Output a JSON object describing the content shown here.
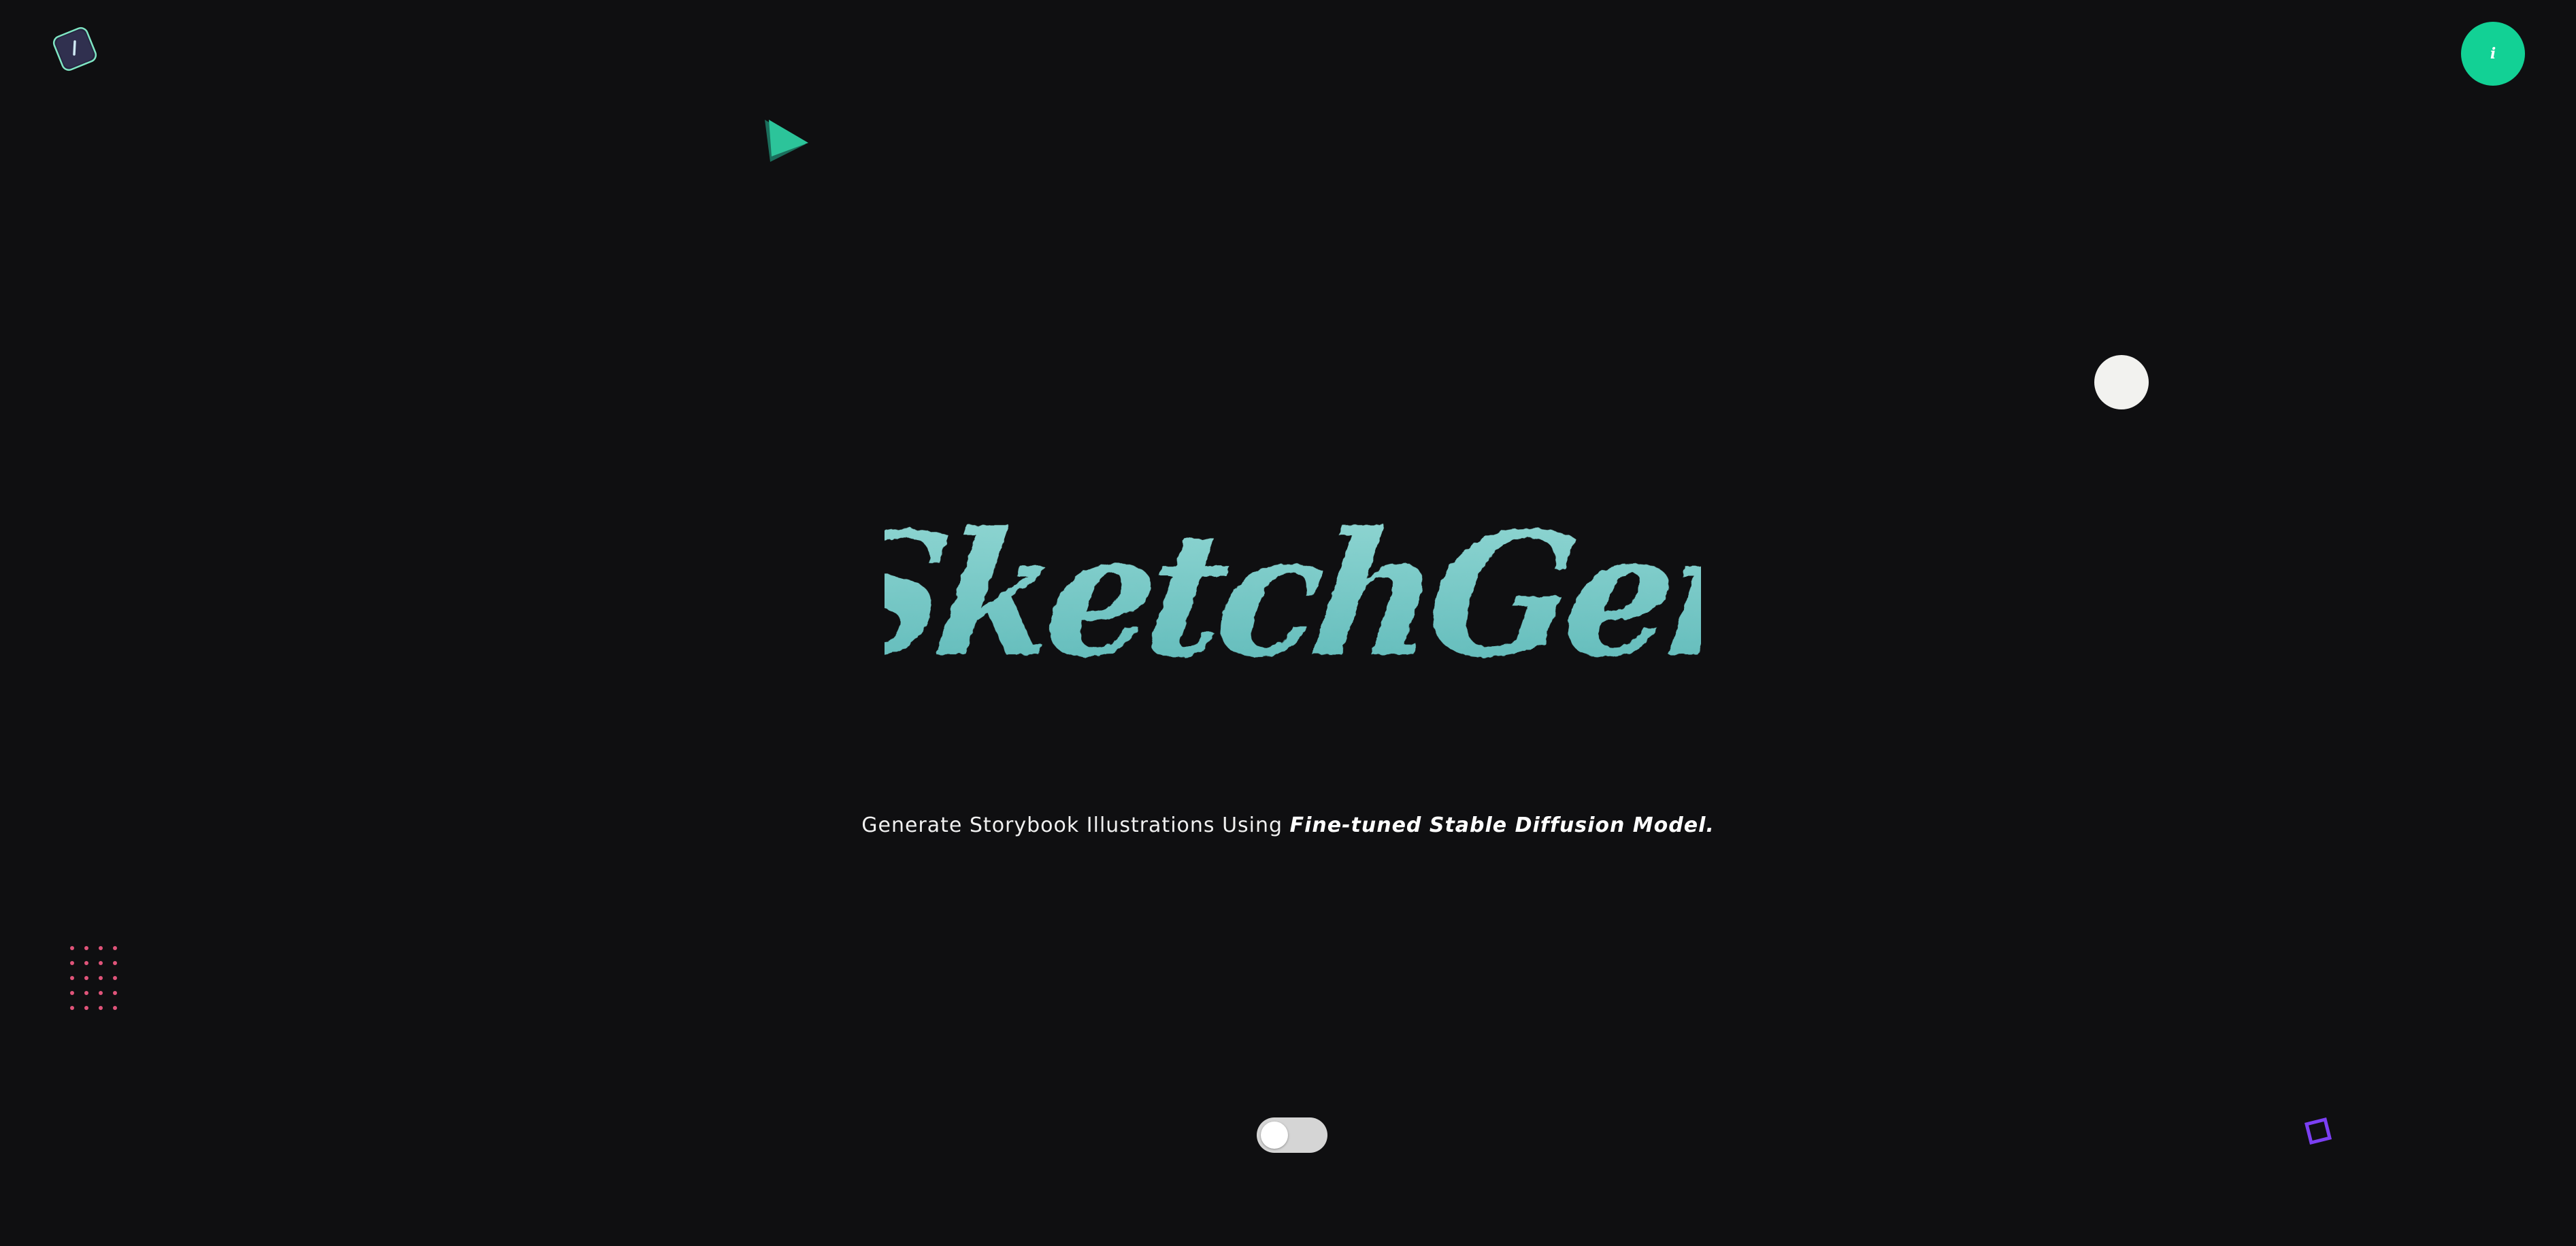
{
  "app": {
    "title": "SketchGen",
    "subtitle_plain": "Generate Storybook Illustrations Using ",
    "subtitle_emphasis": "Fine-tuned Stable Diffusion Model."
  },
  "header": {
    "logo_icon": "logo-icon",
    "info_button": {
      "label": "i",
      "icon": "info-icon"
    }
  },
  "theme_toggle": {
    "state": "off"
  },
  "colors": {
    "background": "#0f0f11",
    "accent": "#12d195",
    "title_gradient_top": "#93d8d4",
    "title_gradient_bottom": "#5cb8b8",
    "subtitle_text": "#f0f0f0",
    "dot_grid": "#e0547a",
    "purple_square": "#7b3ff2",
    "triangle_light": "#2cc49a",
    "triangle_dark": "#1b6e5c",
    "white_circle": "#f2f2ef"
  }
}
